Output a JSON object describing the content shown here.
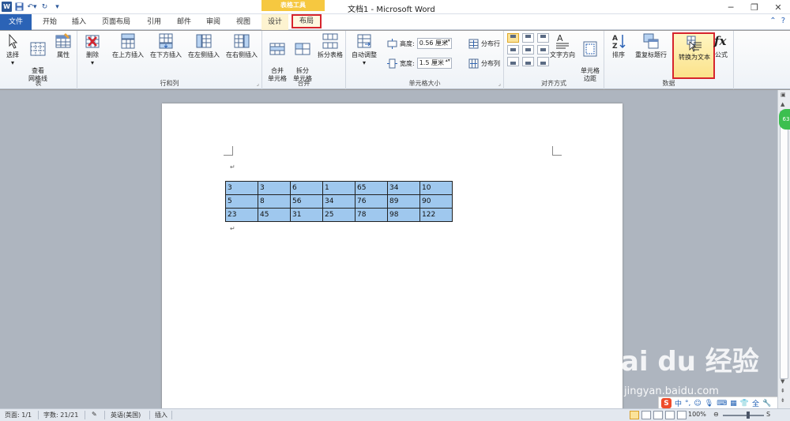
{
  "window": {
    "title": "文档1 - Microsoft Word",
    "context_group": "表格工具",
    "logo": "W"
  },
  "tabs": {
    "file": "文件",
    "home": "开始",
    "insert": "插入",
    "page_layout": "页面布局",
    "references": "引用",
    "mailings": "邮件",
    "review": "审阅",
    "view": "视图",
    "design": "设计",
    "layout": "布局"
  },
  "ribbon": {
    "table": {
      "label": "表",
      "select": "选择",
      "gridlines": "查看\n网格线",
      "properties": "属性"
    },
    "rows_cols": {
      "label": "行和列",
      "delete": "删除",
      "insert_above": "在上方插入",
      "insert_below": "在下方插入",
      "insert_left": "在左侧插入",
      "insert_right": "在右侧插入"
    },
    "merge": {
      "label": "合并",
      "merge_cells": "合并\n单元格",
      "split_cells": "拆分\n单元格",
      "split_table": "拆分表格"
    },
    "cell_size": {
      "label": "单元格大小",
      "autofit": "自动调整",
      "height_label": "高度:",
      "height_value": "0.56 厘米",
      "width_label": "宽度:",
      "width_value": "1.5 厘米",
      "distribute_rows": "分布行",
      "distribute_cols": "分布列"
    },
    "alignment": {
      "label": "对齐方式",
      "text_direction": "文字方向",
      "cell_margins": "单元格\n边距"
    },
    "data": {
      "label": "数据",
      "sort": "排序",
      "repeat_header": "重复标题行",
      "convert_to_text": "转换为文本",
      "formula": "公式"
    }
  },
  "document": {
    "table": [
      [
        "3",
        "3",
        "6",
        "1",
        "65",
        "34",
        "10"
      ],
      [
        "5",
        "8",
        "56",
        "34",
        "76",
        "89",
        "90"
      ],
      [
        "23",
        "45",
        "31",
        "25",
        "78",
        "98",
        "122"
      ]
    ],
    "para_mark": "↵"
  },
  "ime": {
    "logo": "S",
    "mode": "中"
  },
  "watermark": {
    "brand": "Bai du 经验",
    "url": "jingyan.baidu.com"
  },
  "side_badge": "63",
  "statusbar": {
    "page": "页面: 1/1",
    "words": "字数: 21/21",
    "language": "英语(美国)",
    "mode": "插入",
    "zoom": "100%"
  },
  "colors": {
    "accent": "#2b63b6",
    "context_tab": "#f6c840",
    "highlight_red": "#d6252d",
    "cell_selection": "#9fc8ee"
  }
}
